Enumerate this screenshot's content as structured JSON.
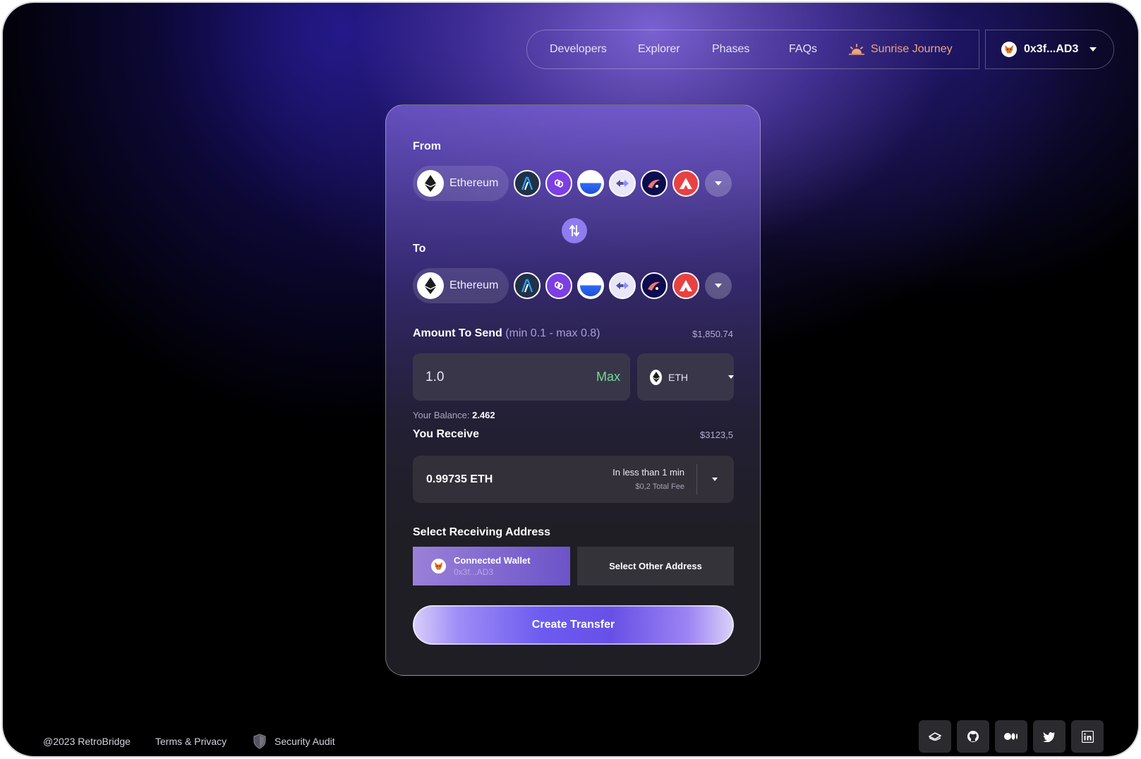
{
  "nav": {
    "links": [
      "Developers",
      "Explorer",
      "Phases",
      "FAQs"
    ],
    "sunrise_label": "Sunrise Journey",
    "wallet_label": "0x3f...AD3"
  },
  "bridge": {
    "from_label": "From",
    "to_label": "To",
    "from_chain": "Ethereum",
    "to_chain": "Ethereum",
    "networks": [
      "arbitrum-icon",
      "polygon-icon",
      "base-icon",
      "zksync-icon",
      "starknet-icon",
      "avalanche-icon"
    ],
    "amount_label": "Amount To Send",
    "amount_range": "(min 0.1 - max 0.8)",
    "amount_usd": "$1,850.74",
    "amount_value": "1.0",
    "max_label": "Max",
    "token": "ETH",
    "balance_label": "Your Balance:",
    "balance_value": "2.462",
    "receive_label": "You Receive",
    "receive_usd": "$3123,5",
    "receive_value": "0.99735 ETH",
    "receive_time": "In less than 1 min",
    "receive_fee": "$0,2 Total Fee",
    "address_label": "Select Receiving Address",
    "connected_title": "Connected Wallet",
    "connected_address": "0x3f...AD3",
    "other_address_label": "Select Other Address",
    "create_label": "Create Transfer"
  },
  "footer": {
    "copyright": "@2023 RetroBridge",
    "terms": "Terms & Privacy",
    "audit": "Security Audit",
    "socials": [
      "gitbook-icon",
      "github-icon",
      "medium-icon",
      "twitter-icon",
      "linkedin-icon"
    ]
  },
  "colors": {
    "accent": "#8f7cf0",
    "max": "#6fdc93",
    "sunrise": "#f2a57a"
  }
}
